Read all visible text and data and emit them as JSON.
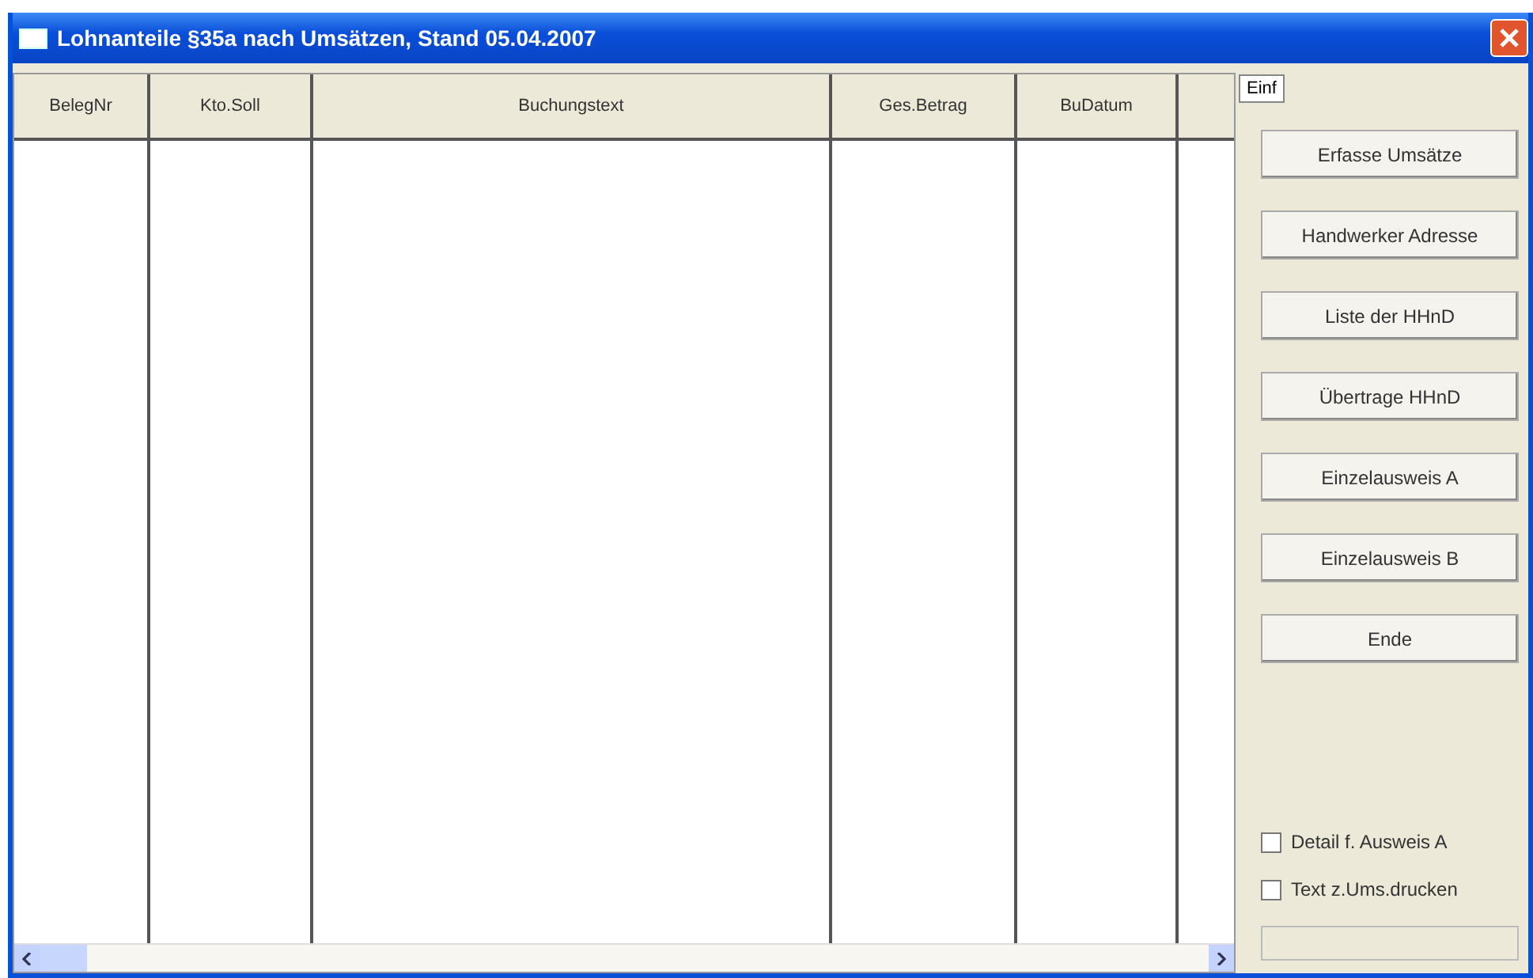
{
  "window": {
    "title": "Lohnanteile §35a nach Umsätzen, Stand 05.04.2007"
  },
  "table": {
    "columns": [
      "BelegNr",
      "Kto.Soll",
      "Buchungstext",
      "Ges.Betrag",
      "BuDatum"
    ]
  },
  "panel": {
    "tab": "Einf",
    "buttons": [
      "Erfasse Umsätze",
      "Handwerker Adresse",
      "Liste der HHnD",
      "Übertrage HHnD",
      "Einzelausweis A",
      "Einzelausweis B",
      "Ende"
    ],
    "checkboxes": [
      {
        "label": "Detail f. Ausweis A",
        "checked": false
      },
      {
        "label": "Text z.Ums.drucken",
        "checked": false
      }
    ]
  }
}
